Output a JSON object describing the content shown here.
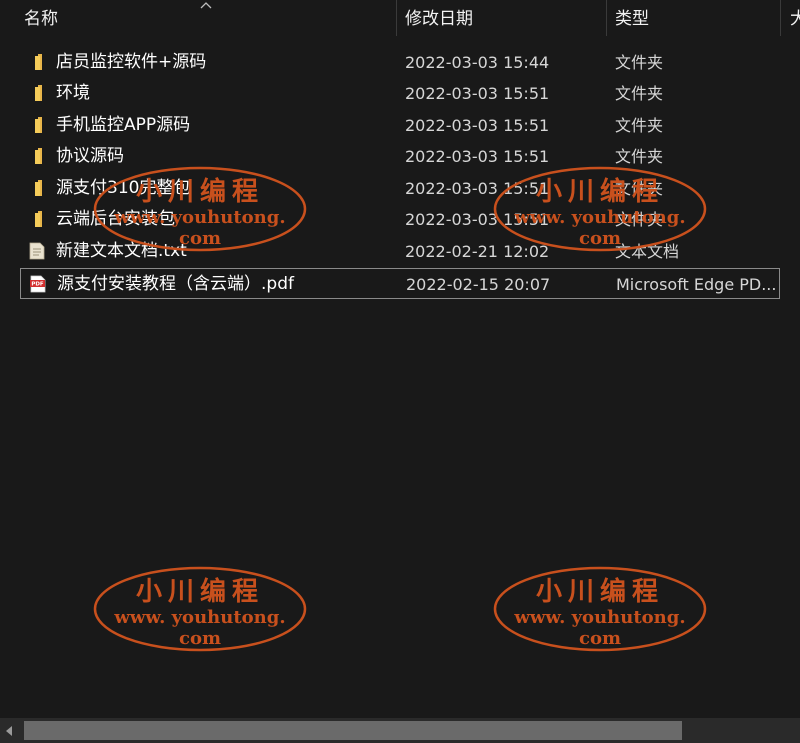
{
  "columns": {
    "name": "名称",
    "date": "修改日期",
    "type": "类型",
    "size": "大"
  },
  "files": [
    {
      "name": "店员监控软件+源码",
      "date": "2022-03-03 15:44",
      "type": "文件夹",
      "icon": "folder-icon"
    },
    {
      "name": "环境",
      "date": "2022-03-03 15:51",
      "type": "文件夹",
      "icon": "folder-icon"
    },
    {
      "name": "手机监控APP源码",
      "date": "2022-03-03 15:51",
      "type": "文件夹",
      "icon": "folder-icon"
    },
    {
      "name": "协议源码",
      "date": "2022-03-03 15:51",
      "type": "文件夹",
      "icon": "folder-icon"
    },
    {
      "name": "源支付310完整包",
      "date": "2022-03-03 15:51",
      "type": "文件夹",
      "icon": "folder-icon"
    },
    {
      "name": "云端后台安装包",
      "date": "2022-03-03 15:51",
      "type": "文件夹",
      "icon": "folder-icon"
    },
    {
      "name": "新建文本文档.txt",
      "date": "2022-02-21 12:02",
      "type": "文本文档",
      "icon": "text-file-icon"
    },
    {
      "name": "源支付安装教程（含云端）.pdf",
      "date": "2022-02-15 20:07",
      "type": "Microsoft Edge PD...",
      "icon": "pdf-file-icon",
      "selected": true
    }
  ],
  "watermark": {
    "title": "小川编程",
    "url": "www. youhutong. com"
  },
  "colors": {
    "background": "#191919",
    "watermark": "#c8501d",
    "folder": "#f0c050",
    "pdf": "#d32f2f"
  }
}
